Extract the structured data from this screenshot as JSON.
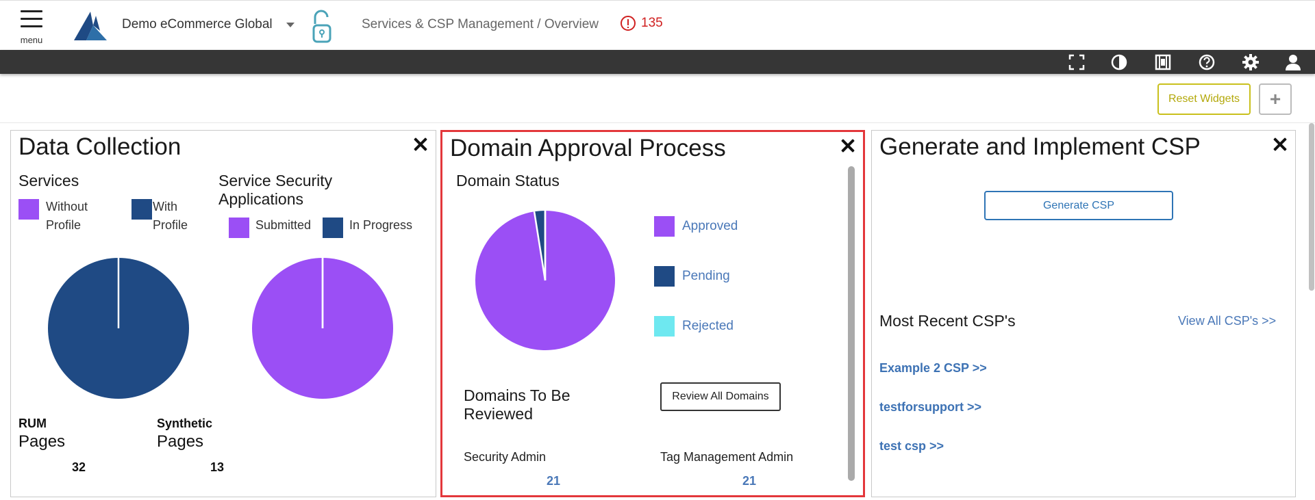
{
  "header": {
    "menu_label": "menu",
    "org_name": "Demo eCommerce Global",
    "breadcrumb": "Services & CSP Management / Overview",
    "alert_count": "135"
  },
  "toolbar": {
    "icons": [
      "fullscreen-icon",
      "contrast-icon",
      "film-icon",
      "help-icon",
      "settings-icon",
      "user-icon"
    ]
  },
  "actions": {
    "reset_label": "Reset Widgets",
    "add_label": "+"
  },
  "colors": {
    "purple": "#9b4ff5",
    "navy": "#1f4a84",
    "cyan": "#6ee8f0",
    "alert_red": "#d02020",
    "link_blue": "#4a78b8"
  },
  "widgets": {
    "data_collection": {
      "title": "Data Collection",
      "services": {
        "heading": "Services",
        "legend": [
          "Without Profile",
          "With Profile"
        ]
      },
      "security": {
        "heading": "Service Security Applications",
        "legend": [
          "Submitted",
          "In Progress"
        ]
      },
      "rum": {
        "label": "RUM",
        "pages_label": "Pages",
        "value": "32"
      },
      "synthetic": {
        "label": "Synthetic",
        "pages_label": "Pages",
        "value": "13"
      }
    },
    "domain_approval": {
      "title": "Domain Approval Process",
      "status_heading": "Domain Status",
      "legend": [
        "Approved",
        "Pending",
        "Rejected"
      ],
      "review_heading": "Domains To Be Reviewed",
      "review_button": "Review All Domains",
      "roles": [
        {
          "label": "Security Admin",
          "value": "21"
        },
        {
          "label": "Tag Management Admin",
          "value": "21"
        }
      ]
    },
    "csp": {
      "title": "Generate and Implement CSP",
      "generate_button": "Generate CSP",
      "recent_heading": "Most Recent CSP's",
      "view_all": "View All CSP's >>",
      "recent": [
        "Example 2 CSP >>",
        "testforsupport >>",
        "test csp >>"
      ]
    }
  },
  "chart_data": [
    {
      "type": "pie",
      "categories": [
        "Without Profile",
        "With Profile"
      ],
      "values": [
        0,
        100
      ]
    },
    {
      "type": "pie",
      "categories": [
        "Submitted",
        "In Progress"
      ],
      "values": [
        100,
        0
      ]
    },
    {
      "type": "pie",
      "categories": [
        "Approved",
        "Pending",
        "Rejected"
      ],
      "values": [
        97.5,
        2.5,
        0
      ]
    }
  ]
}
